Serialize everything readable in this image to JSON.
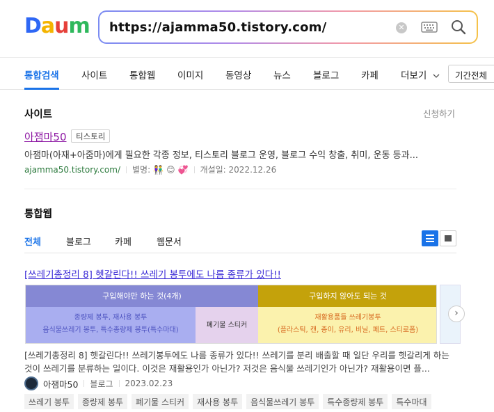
{
  "header": {
    "logo_letters": [
      "D",
      "a",
      "u",
      "m"
    ],
    "logo_colors": [
      "#2e67f5",
      "#f4b400",
      "#e6403a",
      "#2eb85c"
    ],
    "search_query": "https://ajamma50.tistory.com/"
  },
  "nav": {
    "tabs": [
      "통합검색",
      "사이트",
      "통합웹",
      "이미지",
      "동영상",
      "뉴스",
      "블로그",
      "카페",
      "더보기"
    ],
    "period_label": "기간전체"
  },
  "site_section": {
    "title": "사이트",
    "apply_link": "신청하기",
    "site_name": "아잼마50",
    "site_badge": "티스토리",
    "description": "아잼마(아재+아줌마)에게 필요한 각종 정보, 티스토리 블로그 운영, 블로그 수익 창출, 취미, 운동 등과...",
    "url": "ajamma50.tistory.com/",
    "alias_label": "별명:",
    "opened_label": "개설일: 2022.12.26"
  },
  "web_section": {
    "title": "통합웹",
    "subtabs": [
      "전체",
      "블로그",
      "카페",
      "웹문서"
    ],
    "post": {
      "title": "[쓰레기총정리 8] 헷갈린다!! 쓰레기 봉투에도 나름 종류가 있다!!",
      "thumbnail": {
        "header_left": "구입해야만 하는 것(4개)",
        "header_right": "구입하지 않아도 되는 것",
        "body_left_line1": "종량제 봉투, 재사용 봉투",
        "body_left_line2": "음식물쓰레기 봉투, 특수종량제 봉투(특수마대)",
        "body_mid": "폐기물 스티커",
        "body_right_line1": "재활용품들 쓰레기봉투",
        "body_right_line2": "(플라스틱, 캔, 종이, 유리, 비닐, 페트, 스티로폼)"
      },
      "description": "[쓰레기총정리 8] 헷갈린다!! 쓰레기봉투에도 나름 종류가 있다!! 쓰레기를 분리 배출할 때 일단 우리를 헷갈리게 하는 것이 쓰레기를 분류하는 일이다. 이것은 재활용인가 아닌가? 저것은 음식물 쓰레기인가 아닌가? 재활용이면 플...",
      "author": "아잼마50",
      "source": "블로그",
      "date": "2023.02.23",
      "tags": [
        "쓰레기 봉투",
        "종량제 봉투",
        "폐기물 스티커",
        "재사용 봉투",
        "음식물쓰레기 봉투",
        "특수종량제 봉투",
        "특수마대"
      ]
    }
  }
}
